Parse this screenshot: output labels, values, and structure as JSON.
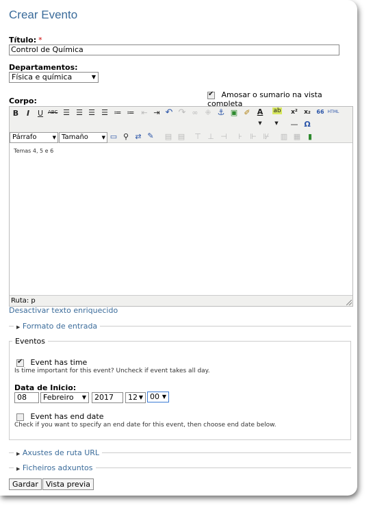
{
  "page": {
    "title": "Crear Evento"
  },
  "titulo": {
    "label": "Título:",
    "required": "*",
    "value": "Control de Química"
  },
  "departamentos": {
    "label": "Departamentos:",
    "value": "Física e química"
  },
  "summary": {
    "label": "Amosar o sumario na vista completa",
    "checked": true
  },
  "corpo": {
    "label": "Corpo:",
    "toolbar": {
      "row1": [
        "bold-icon",
        "italic-icon",
        "underline-icon",
        "strikethrough-icon",
        "align-left-icon",
        "align-center-icon",
        "align-right-icon",
        "align-justify-icon",
        "bullet-list-icon",
        "numbered-list-icon",
        "outdent-icon",
        "indent-icon",
        "undo-icon",
        "redo-icon",
        "link-icon",
        "unlink-icon",
        "anchor-icon",
        "image-icon",
        "cleanup-icon",
        "text-color-icon",
        "highlight-icon",
        "superscript-icon",
        "subscript-icon",
        "quote-icon",
        "html-icon"
      ],
      "format_select": "Párrafo",
      "size_select": "Tamaño",
      "glyphs": {
        "bold": "B",
        "italic": "I",
        "underline": "U",
        "strike": "ABC",
        "text_color": "A",
        "highlight": "ab",
        "superscript": "x²",
        "subscript": "x₂",
        "quote": "66",
        "html": "HTML",
        "omega": "Ω",
        "hr": "—"
      }
    },
    "content": "Temas 4, 5 e 6",
    "path": "Ruta: p",
    "disable_rich": "Desactivar texto enriquecido"
  },
  "formato": {
    "label": "Formato de entrada"
  },
  "eventos": {
    "legend": "Eventos",
    "has_time": {
      "label": "Event has time",
      "checked": true,
      "help": "Is time important for this event? Uncheck if event takes all day."
    },
    "start": {
      "label": "Data de Inicio:",
      "day": "08",
      "month": "Febreiro",
      "year": "2017",
      "hour": "12",
      "minute": "00"
    },
    "has_end": {
      "label": "Event has end date",
      "checked": false,
      "help": "Check if you want to specify an end date for this event, then choose end date below."
    }
  },
  "axustes": {
    "label": "Axustes de ruta URL"
  },
  "ficheiros": {
    "label": "Ficheiros adxuntos"
  },
  "buttons": {
    "save": "Gardar",
    "preview": "Vista previa"
  }
}
